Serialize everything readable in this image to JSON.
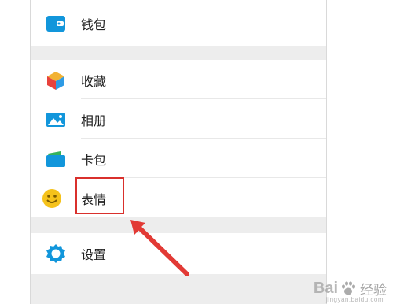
{
  "menu": {
    "items": [
      {
        "id": "wallet",
        "label": "钱包",
        "icon": "wallet-icon"
      },
      {
        "id": "favorites",
        "label": "收藏",
        "icon": "cube-icon"
      },
      {
        "id": "album",
        "label": "相册",
        "icon": "photo-icon"
      },
      {
        "id": "cards",
        "label": "卡包",
        "icon": "card-icon"
      },
      {
        "id": "stickers",
        "label": "表情",
        "icon": "smiley-icon"
      },
      {
        "id": "settings",
        "label": "设置",
        "icon": "gear-icon"
      }
    ]
  },
  "annotation": {
    "highlight_color": "#d9302c",
    "arrow_color": "#e23a35"
  },
  "watermark": {
    "brand": "Bai",
    "brand_suffix": "经验",
    "site": "jingyan.baidu.com",
    "icon": "paw-icon"
  },
  "colors": {
    "group_separator": "#ededed",
    "accent_blue": "#1296db"
  }
}
